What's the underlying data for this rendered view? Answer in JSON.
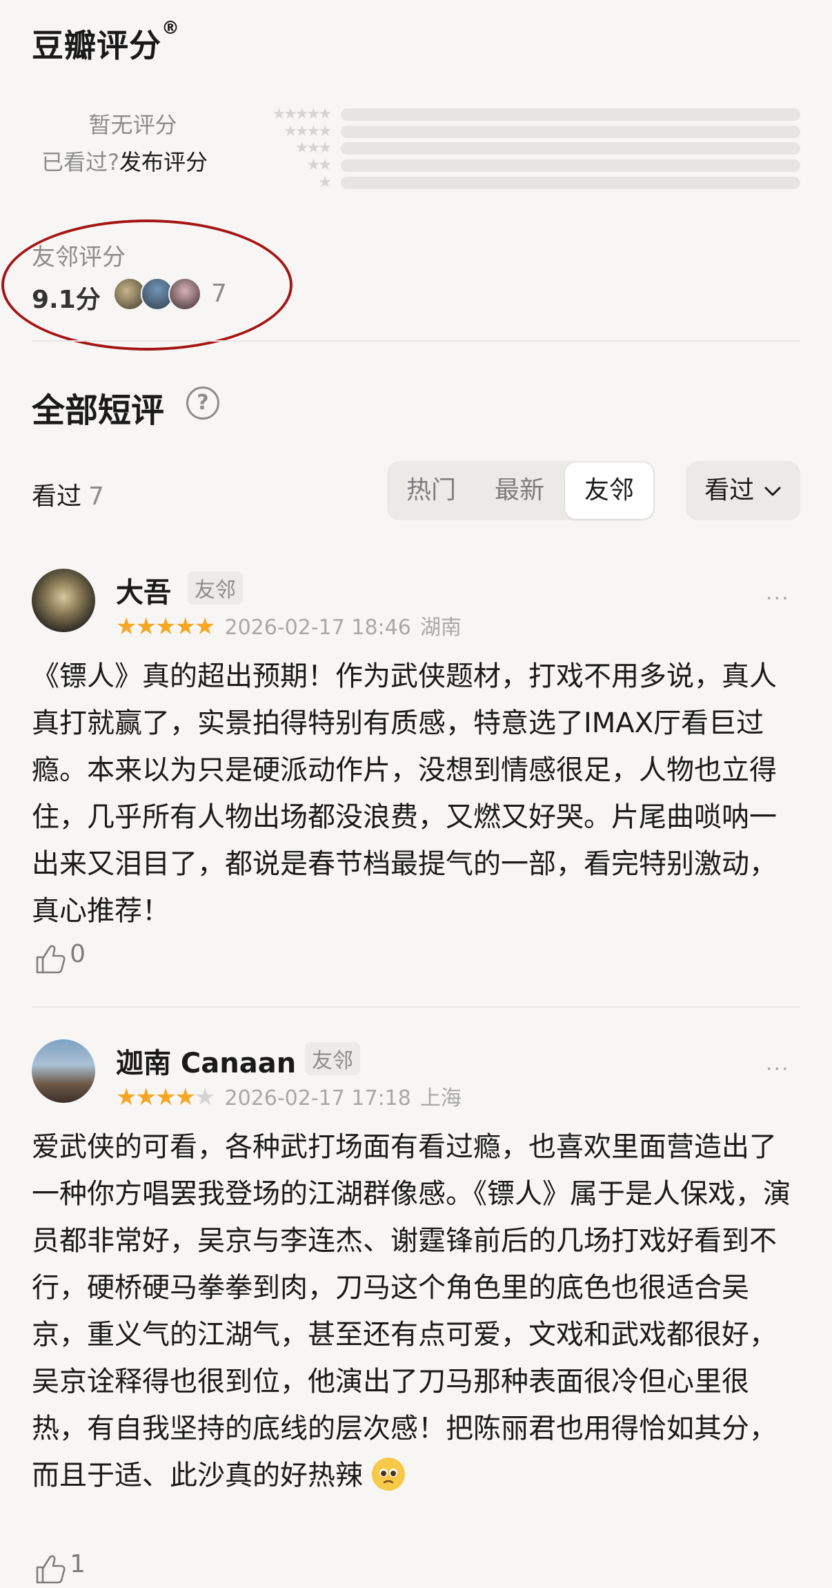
{
  "rating": {
    "title": "豆瓣评分",
    "title_mark": "®",
    "no_rating": "暂无评分",
    "seen_question": "已看过?",
    "post_rating": "发布评分",
    "star_rows": [
      "★★★★★",
      "★★★★",
      "★★★",
      "★★",
      "★"
    ],
    "distribution": [
      0,
      0,
      0,
      0,
      0
    ]
  },
  "neighbor": {
    "label": "友邻评分",
    "score": "9.1分",
    "count": "7"
  },
  "reviews_section": {
    "title": "全部短评",
    "help_icon": "?",
    "seen_label": "看过",
    "seen_count": "7",
    "tabs": [
      "热门",
      "最新",
      "友邻"
    ],
    "active_tab": "友邻",
    "filter": "看过",
    "filter_icon": "chevron-down-icon"
  },
  "reviews": [
    {
      "user": "大吾",
      "tag": "友邻",
      "rating": 5,
      "stars_on": "★★★★★",
      "stars_off": "",
      "date": "2026-02-17 18:46",
      "location": "湖南",
      "text": "《镖人》真的超出预期！作为武侠题材，打戏不用多说，真人真打就赢了，实景拍得特别有质感，特意选了IMAX厅看巨过瘾。本来以为只是硬派动作片，没想到情感很足，人物也立得住，几乎所有人物出场都没浪费，又燃又好哭。片尾曲唢呐一出来又泪目了，都说是春节档最提气的一部，看完特别激动，真心推荐！",
      "likes": "0"
    },
    {
      "user": "迦南 Canaan",
      "tag": "友邻",
      "rating": 4,
      "stars_on": "★★★★",
      "stars_off": "★",
      "date": "2026-02-17 17:18",
      "location": "上海",
      "text": "爱武侠的可看，各种武打场面有看过瘾，也喜欢里面营造出了一种你方唱罢我登场的江湖群像感。《镖人》属于是人保戏，演员都非常好，吴京与李连杰、谢霆锋前后的几场打戏好看到不行，硬桥硬马拳拳到肉，刀马这个角色里的底色也很适合吴京，重义气的江湖气，甚至还有点可爱，文戏和武戏都很好，吴京诠释得也很到位，他演出了刀马那种表面很冷但心里很热，有自我坚持的底线的层次感！把陈丽君也用得恰如其分，而且于适、此沙真的好热辣",
      "likes": "1"
    }
  ],
  "more_icon": "···",
  "colors": {
    "star": "#f6a623",
    "annotation": "#a51515",
    "background": "#f7f6f4"
  }
}
